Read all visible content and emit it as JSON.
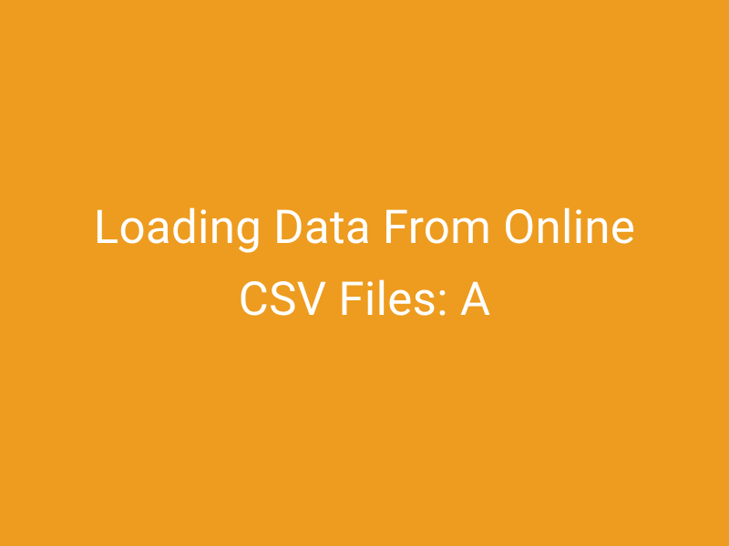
{
  "colors": {
    "background": "#ed9c1f",
    "text": "#ffffff"
  },
  "title": {
    "text": "Loading Data From Online CSV Files: A"
  }
}
